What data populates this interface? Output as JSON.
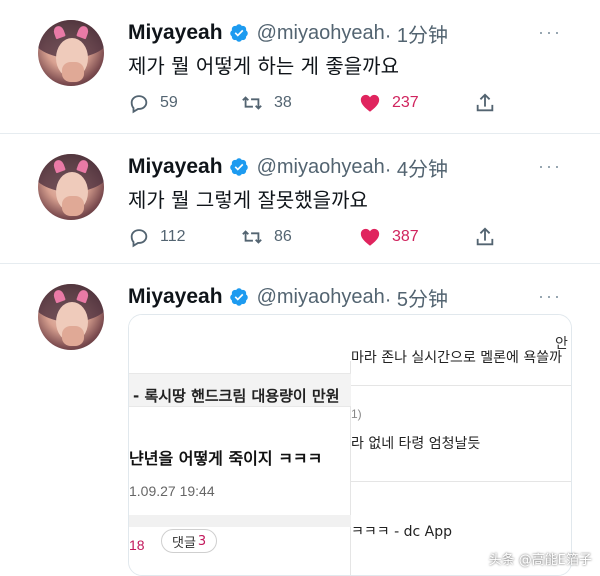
{
  "colors": {
    "verified": "#1d9bf0",
    "like": "#d0245e",
    "muted": "#536471"
  },
  "tweets": [
    {
      "name": "Miyayeah",
      "handle": "@miyaohyeah",
      "time": "· 1分钟",
      "text": "제가 뭘 어떻게 하는 게 좋을까요",
      "replies": "59",
      "retweets": "38",
      "likes": "237"
    },
    {
      "name": "Miyayeah",
      "handle": "@miyaohyeah",
      "time": "· 4分钟",
      "text": "제가 뭘 그렇게 잘못했을까요",
      "replies": "112",
      "retweets": "86",
      "likes": "387"
    },
    {
      "name": "Miyayeah",
      "handle": "@miyaohyeah",
      "time": "· 5分钟",
      "media": {
        "left": {
          "title": "- 록시땅 핸드크림 대용량이 만원",
          "post_title": "냔년을 어떻게 죽이지 ㅋㅋㅋ ",
          "date": "1.09.27 19:44",
          "count": "18",
          "reply_label": "댓글",
          "reply_count": "3"
        },
        "right": {
          "top_char": "안",
          "line1": "마라 존나 실시간으로 멜론에 욕쓸까",
          "num": "1)",
          "line2": "라 없네 타령 엄청날듯",
          "line3": "ㅋㅋㅋ - dc App"
        }
      }
    }
  ],
  "more_label": "···",
  "watermark": "头条 @高能E箔子"
}
